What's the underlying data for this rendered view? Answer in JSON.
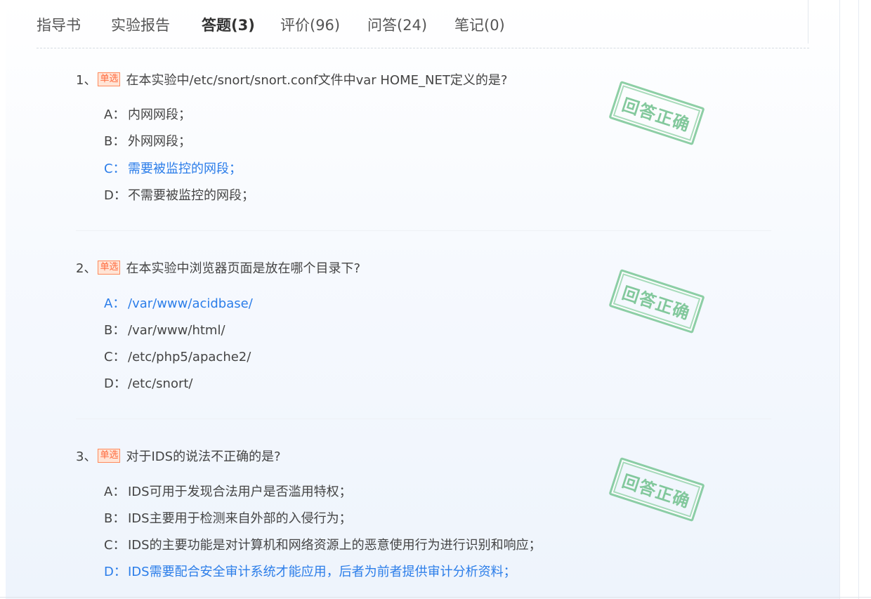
{
  "tabs": [
    {
      "label": "指导书",
      "active": false
    },
    {
      "label": "实验报告",
      "active": false
    },
    {
      "label": "答题(3)",
      "active": true
    },
    {
      "label": "评价(96)",
      "active": false
    },
    {
      "label": "问答(24)",
      "active": false
    },
    {
      "label": "笔记(0)",
      "active": false
    }
  ],
  "questions": [
    {
      "number": "1、",
      "type": "单选",
      "text": "在本实验中/etc/snort/snort.conf文件中var HOME_NET定义的是?",
      "options": [
        {
          "letter": "A：",
          "text": "内网网段；",
          "correct": false
        },
        {
          "letter": "B：",
          "text": "外网网段；",
          "correct": false
        },
        {
          "letter": "C：",
          "text": "需要被监控的网段；",
          "correct": true
        },
        {
          "letter": "D：",
          "text": "不需要被监控的网段；",
          "correct": false
        }
      ],
      "stamp": "回答正确"
    },
    {
      "number": "2、",
      "type": "单选",
      "text": "在本实验中浏览器页面是放在哪个目录下?",
      "options": [
        {
          "letter": "A：",
          "text": "/var/www/acidbase/",
          "correct": true
        },
        {
          "letter": "B：",
          "text": "/var/www/html/",
          "correct": false
        },
        {
          "letter": "C：",
          "text": "/etc/php5/apache2/",
          "correct": false
        },
        {
          "letter": "D：",
          "text": "/etc/snort/",
          "correct": false
        }
      ],
      "stamp": "回答正确"
    },
    {
      "number": "3、",
      "type": "单选",
      "text": "对于IDS的说法不正确的是?",
      "options": [
        {
          "letter": "A：",
          "text": "IDS可用于发现合法用户是否滥用特权；",
          "correct": false
        },
        {
          "letter": "B：",
          "text": "IDS主要用于检测来自外部的入侵行为；",
          "correct": false
        },
        {
          "letter": "C：",
          "text": "IDS的主要功能是对计算机和网络资源上的恶意使用行为进行识别和响应；",
          "correct": false
        },
        {
          "letter": "D：",
          "text": "IDS需要配合安全审计系统才能应用，后者为前者提供审计分析资料；",
          "correct": true
        }
      ],
      "stamp": "回答正确"
    }
  ],
  "colors": {
    "correct_option": "#2b7de9",
    "tag_text": "#ff6a3d",
    "stamp": "#6fc08c"
  }
}
